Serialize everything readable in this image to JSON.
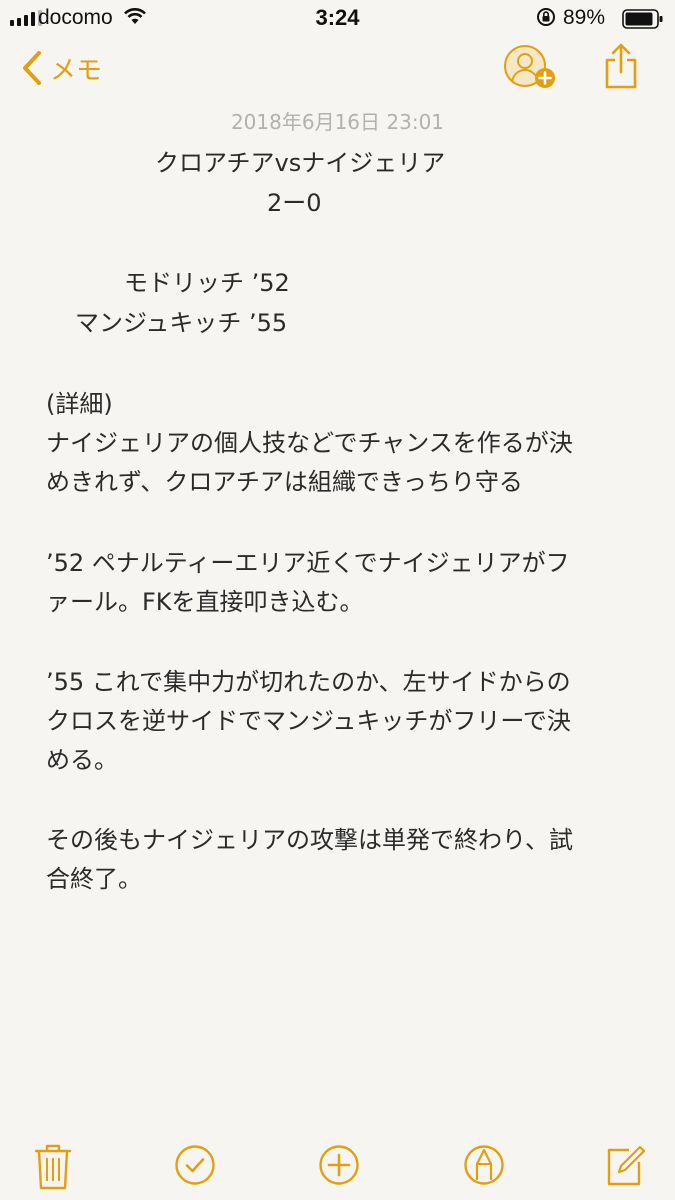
{
  "status_bar": {
    "carrier": "docomo",
    "time": "3:24",
    "battery": "89%",
    "signal_bars_filled": 4,
    "signal_bars_total": 5
  },
  "nav": {
    "back_label": "メモ",
    "accent_color": "#e2a010"
  },
  "note": {
    "date": "2018年6月16日 23:01",
    "lines": [
      "クロアチアvsナイジェリア",
      "2ー0",
      "モドリッチ ’52",
      "マンジュキッチ ’55",
      "(詳細)",
      "ナイジェリアの個人技などでチャンスを作るが決",
      "めきれず、クロアチアは組織できっちり守る",
      "’52 ペナルティーエリア近くでナイジェリアがフ",
      "ァール。FKを直接叩き込む。",
      "’55  これで集中力が切れたのか、左サイドからの",
      "クロスを逆サイドでマンジュキッチがフリーで決",
      "める。",
      "その後もナイジェリアの攻撃は単発で終わり、試",
      "合終了。"
    ]
  },
  "toolbar": {
    "icons": [
      "trash-icon",
      "checklist-icon",
      "add-icon",
      "markup-icon",
      "compose-icon"
    ]
  }
}
